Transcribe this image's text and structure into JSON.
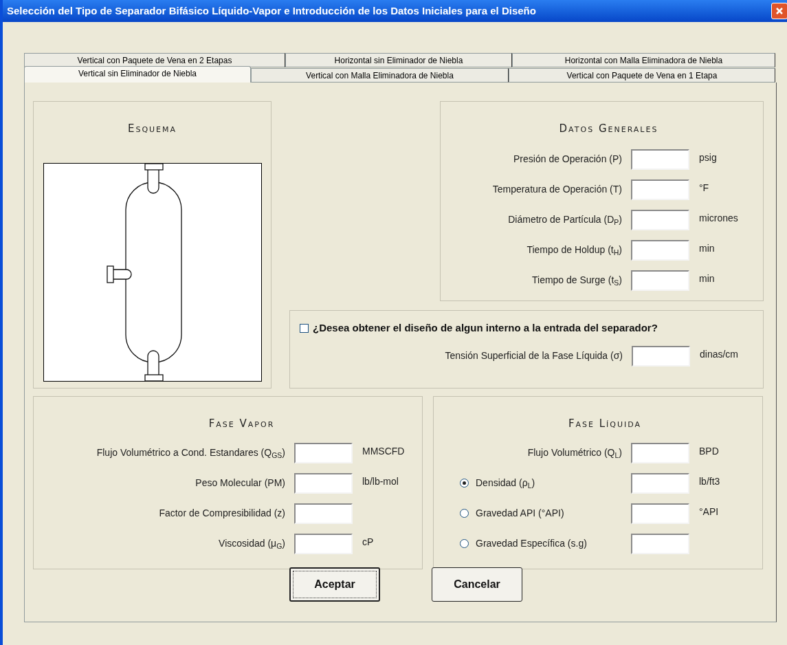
{
  "window": {
    "title": "Selección del Tipo de Separador Bifásico Líquido-Vapor e Introducción de los Datos Iniciales para el Diseño"
  },
  "tab_rows": [
    {
      "tabs": [
        {
          "label": "Vertical con Paquete de Vena en 2 Etapas",
          "selected": false
        },
        {
          "label": "Horizontal sin Eliminador de Niebla",
          "selected": false
        },
        {
          "label": "Horizontal con Malla Eliminadora de Niebla",
          "selected": false
        }
      ]
    },
    {
      "tabs": [
        {
          "label": "Vertical sin Eliminador de Niebla",
          "selected": true
        },
        {
          "label": "Vertical con Malla Eliminadora de Niebla",
          "selected": false
        },
        {
          "label": "Vertical con Paquete de Vena en 1 Etapa",
          "selected": false
        }
      ]
    }
  ],
  "schema": {
    "title": "Esquema"
  },
  "general_data": {
    "title": "Datos Generales",
    "rows": [
      {
        "label": "Presión de Operación (P)",
        "unit": "psig"
      },
      {
        "label": "Temperatura de Operación (T)",
        "unit": "°F"
      },
      {
        "label": "Diámetro de Partícula (D$_{P}$)",
        "unit": "micrones"
      },
      {
        "label": "Tiempo de Holdup (t$_{H}$)",
        "unit": "min"
      },
      {
        "label": "Tiempo de Surge (t$_{S}$)",
        "unit": "min"
      }
    ]
  },
  "inlet_internal": {
    "checkbox": {
      "label": "¿Desea obtener el diseño de algun interno a la entrada del separador?",
      "checked": false
    },
    "row": {
      "label": "Tensión Superficial de la Fase Líquida (σ)",
      "unit": "dinas/cm"
    }
  },
  "vapor_phase": {
    "title": "Fase Vapor",
    "rows": [
      {
        "label": "Flujo Volumétrico a Cond. Estandares (Q$_{GS}$)",
        "unit": "MMSCFD"
      },
      {
        "label": "Peso Molecular (PM)",
        "unit": "lb/lb-mol"
      },
      {
        "label": "Factor de Compresibilidad (z)"
      },
      {
        "label": "Viscosidad (μ$_{G}$)",
        "unit": "cP"
      }
    ]
  },
  "liquid_phase": {
    "title": "Fase Líquida",
    "rows": [
      {
        "kind": "plain",
        "label": "Flujo Volumétrico (Q$_{L}$)",
        "unit": "BPD"
      },
      {
        "kind": "radio",
        "label": "Densidad (ρ$_{L}$)",
        "unit": "lb/ft3",
        "selected": true
      },
      {
        "kind": "radio",
        "label": "Gravedad API (°API)",
        "unit": "°API",
        "selected": false
      },
      {
        "kind": "radio",
        "label": "Gravedad Específica (s.g)",
        "selected": false
      }
    ]
  },
  "buttons": [
    {
      "label": "Aceptar",
      "focused": true
    },
    {
      "label": "Cancelar",
      "focused": false
    }
  ]
}
